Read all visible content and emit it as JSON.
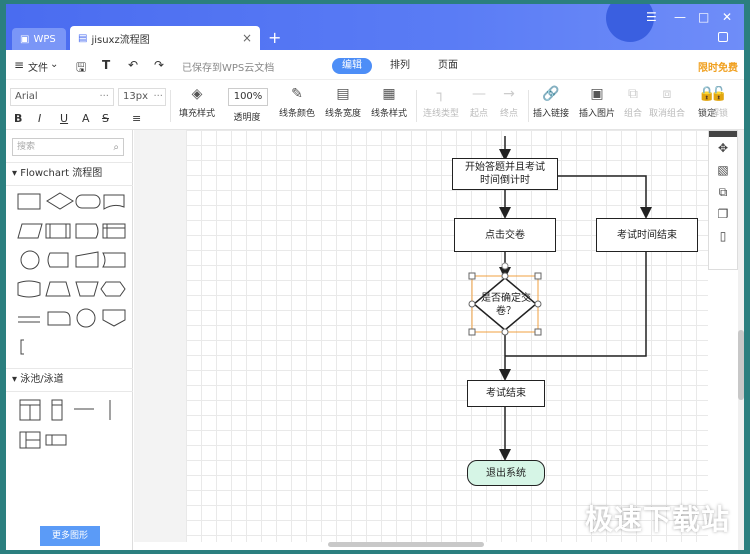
{
  "tabs": {
    "wps": "WPS",
    "doc": "jisuxz流程图"
  },
  "menu": {
    "file": "文件",
    "saved": "已保存到WPS云文档",
    "tab_edit": "编辑",
    "tab_arrange": "排列",
    "tab_page": "页面",
    "free": "限时免费"
  },
  "toolbar": {
    "font": "Arial",
    "font_size": "13px",
    "zoom": "100%",
    "fill": "填充样式",
    "opacity": "透明度",
    "line_color": "线条颜色",
    "line_width": "线条宽度",
    "line_style": "线条样式",
    "conn_type": "连线类型",
    "start": "起点",
    "end": "终点",
    "insert_link": "插入链接",
    "insert_image": "插入图片",
    "group": "组合",
    "ungroup": "取消组合",
    "lock": "锁定",
    "unlock": "解锁"
  },
  "left": {
    "search_placeholder": "搜索",
    "section1": "Flowchart 流程图",
    "section2": "泳池/泳道",
    "more": "更多图形"
  },
  "flow": {
    "n1": "开始答题并且考试\n时间倒计时",
    "n2": "点击交卷",
    "n3": "考试时间结束",
    "n4": "是否确定交\n卷？",
    "n5": "考试结束",
    "n6": "退出系统"
  },
  "watermark": "极速下载站"
}
